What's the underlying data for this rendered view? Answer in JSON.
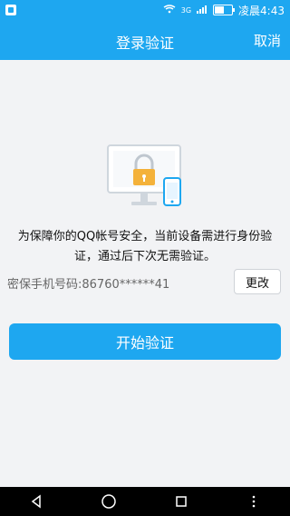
{
  "status_bar": {
    "time": "凌晨4:43",
    "network": "3G",
    "icons": [
      "notification-icon",
      "wifi-icon",
      "signal-icon",
      "battery-icon"
    ]
  },
  "app_bar": {
    "title": "登录验证",
    "cancel_label": "取消"
  },
  "illustration": {
    "name": "device-lock-illustration"
  },
  "message": {
    "line1": "为保障你的QQ帐号安全，当前设备需进行身份验",
    "line2": "证，通过后下次无需验证。"
  },
  "phone": {
    "text": "密保手机号码:86760******41",
    "change_label": "更改"
  },
  "primary": {
    "label": "开始验证"
  },
  "navigation": {
    "buttons": [
      "back-icon",
      "home-icon",
      "recents-icon",
      "menu-icon"
    ]
  },
  "colors": {
    "accent": "#1ea7f0",
    "background": "#f2f3f5"
  }
}
